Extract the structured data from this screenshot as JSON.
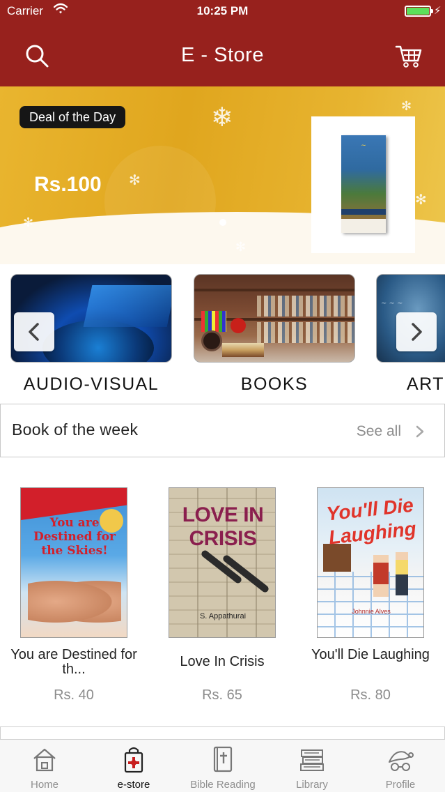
{
  "status_bar": {
    "carrier": "Carrier",
    "time": "10:25 PM"
  },
  "header": {
    "title": "E - Store",
    "search_icon": "search-icon",
    "cart_icon": "cart-icon",
    "background": "#97211d"
  },
  "banner": {
    "badge": "Deal of the Day",
    "price": "Rs.100",
    "accent": "#e3ad27",
    "pages": 1,
    "active_page": 1
  },
  "categories": [
    {
      "label": "AUDIO-VISUAL"
    },
    {
      "label": "BOOKS"
    },
    {
      "label": "ART"
    }
  ],
  "week_section": {
    "title": "Book of the week",
    "see_all": "See all"
  },
  "books": [
    {
      "title": "You are Destined for th...",
      "price": "Rs. 40",
      "cover_title": "You are Destined for the Skies!",
      "cover_author": ""
    },
    {
      "title": "Love In Crisis",
      "price": "Rs. 65",
      "cover_title": "LOVE IN CRISIS",
      "cover_author": "S. Appathurai"
    },
    {
      "title": "You'll Die Laughing",
      "price": "Rs. 80",
      "cover_title": "You'll Die Laughing",
      "cover_author": "Johnnie Alves"
    }
  ],
  "tabbar": {
    "active": "e-store",
    "tabs": [
      {
        "label": "Home",
        "icon": "home-icon"
      },
      {
        "label": "e-store",
        "icon": "shopping-bag-icon"
      },
      {
        "label": "Bible Reading",
        "icon": "bible-icon"
      },
      {
        "label": "Library",
        "icon": "books-stack-icon"
      },
      {
        "label": "Profile",
        "icon": "profile-icon"
      }
    ]
  }
}
